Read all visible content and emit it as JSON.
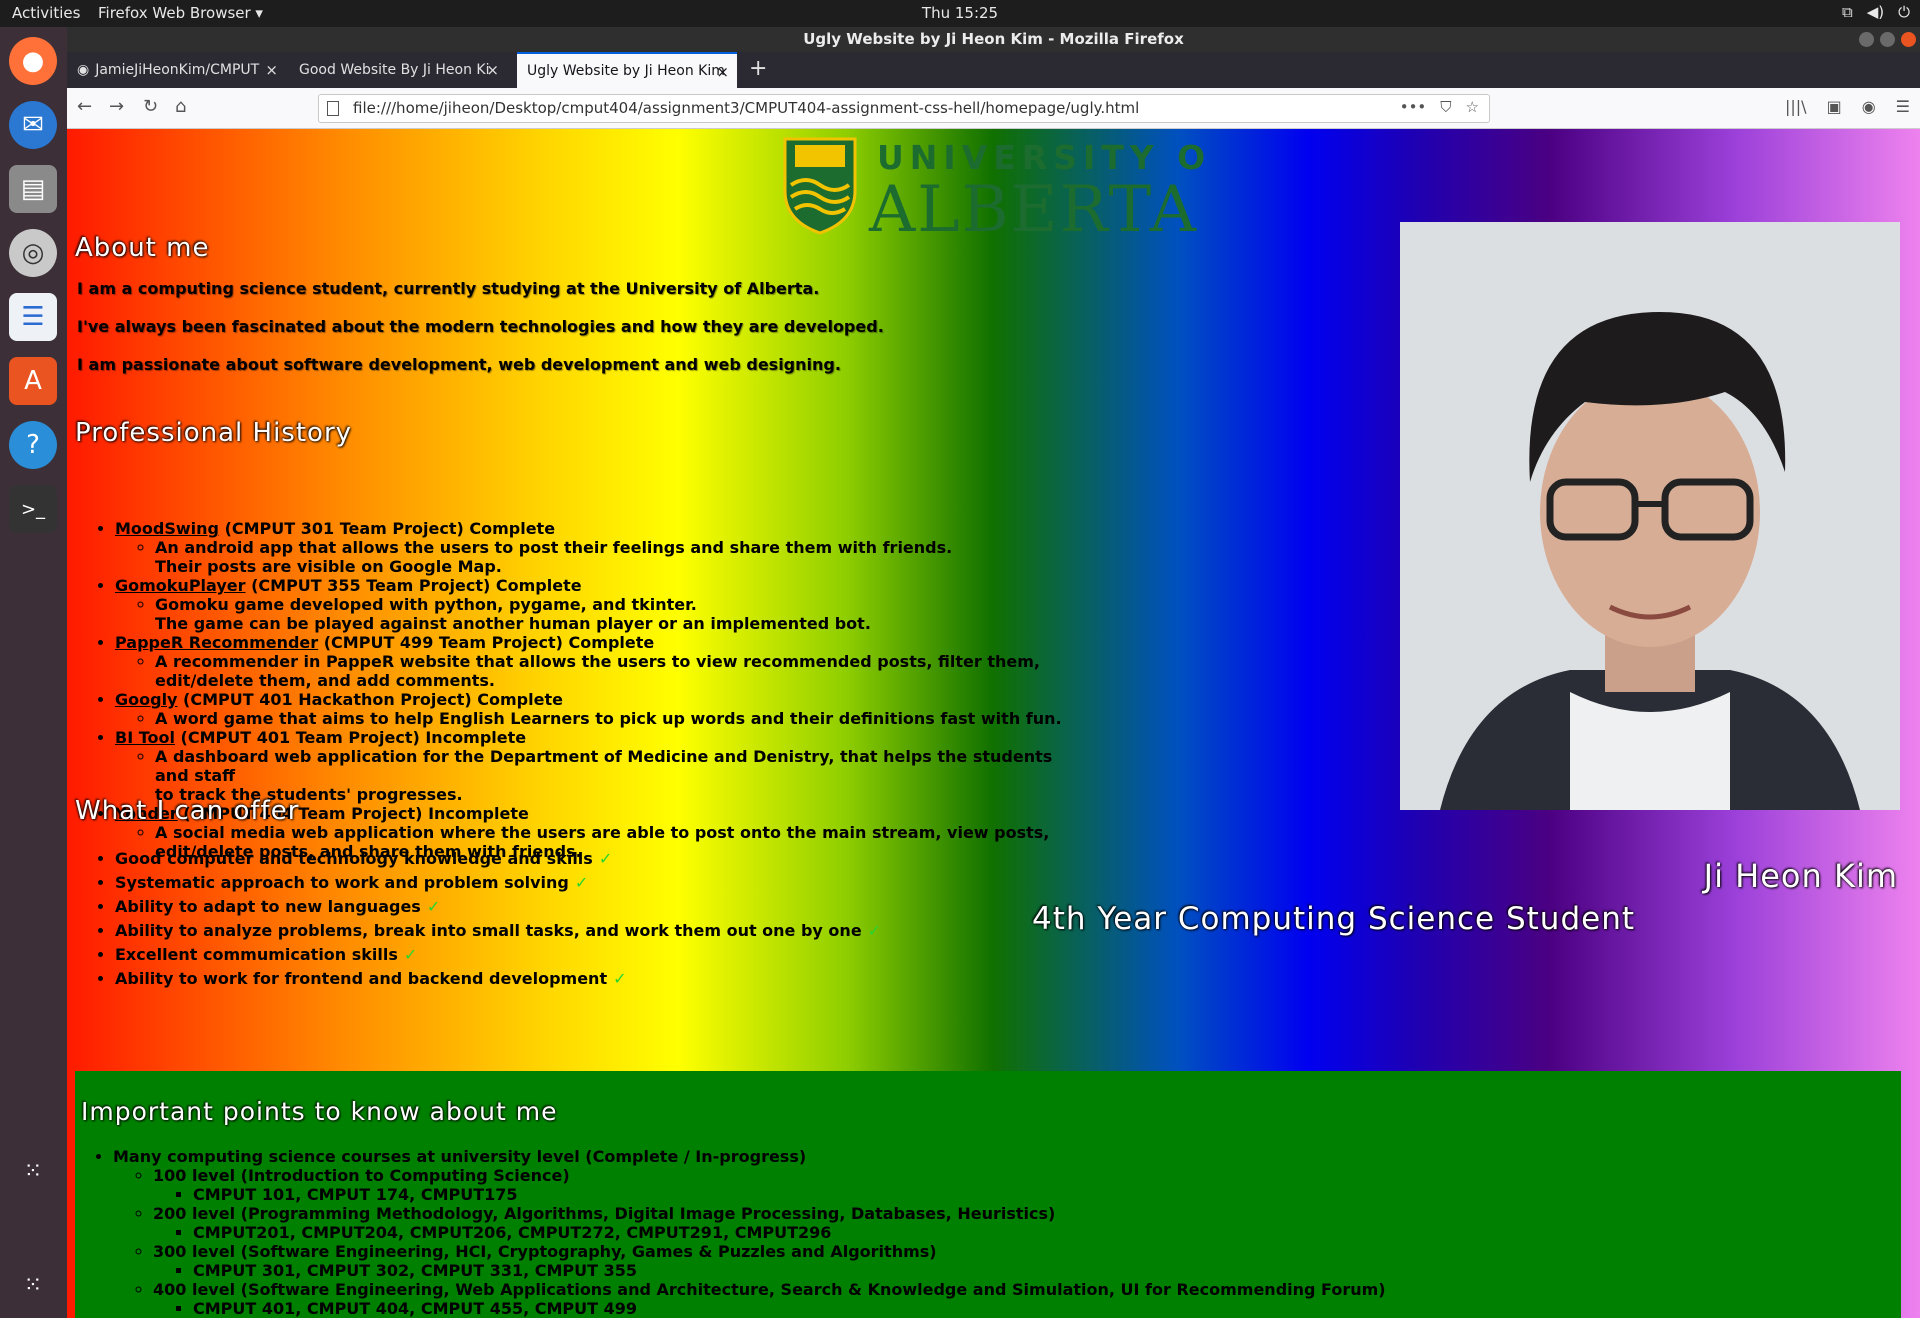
{
  "topbar": {
    "activities": "Activities",
    "app": "Firefox Web Browser ▾",
    "clock": "Thu 15:25"
  },
  "window": {
    "title": "Ugly Website by Ji Heon Kim - Mozilla Firefox"
  },
  "tabs": [
    {
      "label": "JamieJiHeonKim/CMPUT",
      "close": "×"
    },
    {
      "label": "Good Website By Ji Heon Ki",
      "close": "×"
    },
    {
      "label": "Ugly Website by Ji Heon Kim",
      "close": "×"
    }
  ],
  "new_tab": "+",
  "nav": {
    "back": "←",
    "forward": "→",
    "reload": "↻",
    "home": "⌂",
    "url": "file:///home/jiheon/Desktop/cmput404/assignment3/CMPUT404-assignment-css-hell/homepage/ugly.html",
    "more": "•••",
    "pocket": "⛉",
    "star": "☆",
    "library": "|||\\",
    "sidebar": "▣",
    "account": "◉",
    "menu": "☰"
  },
  "logo": {
    "line1": "UNIVERSITY OF",
    "line2": "ALBERTA"
  },
  "about": {
    "heading": "About me",
    "lines": [
      "I am a computing science student, currently studying at the University of Alberta.",
      "I've always been fascinated about the modern technologies and how they are developed.",
      "I am passionate about software development, web development and web designing."
    ]
  },
  "history": {
    "heading": "Professional History",
    "items": [
      {
        "link": "MoodSwing",
        "text": " (CMPUT 301 Team Project) Complete",
        "sub": [
          "An android app that allows the users to post their feelings and share them with friends.",
          "Their posts are visible on Google Map."
        ]
      },
      {
        "link": "GomokuPlayer",
        "text": " (CMPUT 355 Team Project) Complete",
        "sub": [
          "Gomoku game developed with python, pygame, and tkinter.",
          "The game can be played against another human player or an implemented bot."
        ]
      },
      {
        "link": "PappeR Recommender",
        "text": " (CMPUT 499 Team Project) Complete",
        "sub": [
          "A recommender in PappeR website that allows the users to view recommended posts, filter them,",
          "edit/delete them, and add comments."
        ]
      },
      {
        "link": "Googly",
        "text": " (CMPUT 401 Hackathon Project) Complete",
        "sub": [
          "A word game that aims to help English Learners to pick up words and their definitions fast with fun."
        ]
      },
      {
        "link": "BI Tool",
        "text": " (CMPUT 401 Team Project) Incomplete",
        "sub": [
          "A dashboard web application for the Department of Medicine and Denistry, that helps the students and staff",
          "to track the students' progresses."
        ]
      },
      {
        "link": "Yonder",
        "text": " (CMPUT 404 Team Project) Incomplete",
        "sub": [
          "A social media web application where the users are able to post onto the main stream, view posts,",
          "edit/delete posts, and share them with friends."
        ]
      }
    ]
  },
  "offer": {
    "heading": "What I can offer",
    "items": [
      "Good computer and technology knowledge and skills",
      "Systematic approach to work and problem solving",
      "Ability to adapt to new languages",
      "Ability to analyze problems, break into small tasks, and work them out one by one",
      "Excellent commumication skills",
      "Ability to work for frontend and backend development"
    ],
    "check": "✓"
  },
  "profile": {
    "name": "Ji Heon Kim",
    "role": "4th Year Computing Science Student"
  },
  "important": {
    "heading": "Important points to know about me",
    "item": "Many computing science courses at university level (Complete / In-progress)",
    "levels": [
      {
        "label": "100 level (Introduction to Computing Science)",
        "courses": "CMPUT 101, CMPUT 174, CMPUT175"
      },
      {
        "label": "200 level (Programming Methodology, Algorithms, Digital Image Processing, Databases, Heuristics)",
        "courses": "CMPUT201, CMPUT204, CMPUT206, CMPUT272, CMPUT291, CMPUT296"
      },
      {
        "label": "300 level (Software Engineering, HCI, Cryptography, Games & Puzzles and Algorithms)",
        "courses": "CMPUT 301, CMPUT 302, CMPUT 331, CMPUT 355"
      },
      {
        "label": "400 level (Software Engineering, Web Applications and Architecture, Search & Knowledge and Simulation, UI for Recommending Forum)",
        "courses": "CMPUT 401, CMPUT 404, CMPUT 455, CMPUT 499"
      }
    ]
  }
}
